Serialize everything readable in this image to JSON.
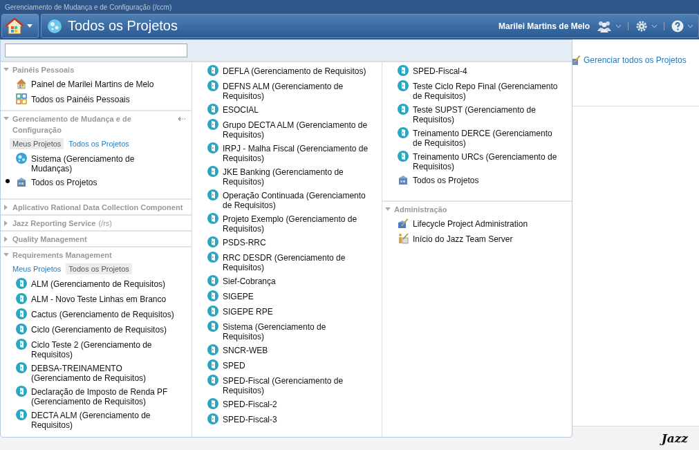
{
  "app_bar": {
    "title": "Gerenciamento de Mudança e de Configuração (/ccm)"
  },
  "nav_bar": {
    "page_title": "Todos os Projetos",
    "user_name": "Marilei Martins de Melo"
  },
  "manage_link": "Gerenciar todos os Projetos",
  "footer": {
    "logo": "Jazz"
  },
  "menu": {
    "columns": [
      {
        "sections": [
          {
            "title": "Painéis Pessoais",
            "expanded": true,
            "items": [
              {
                "label": "Painel de Marilei Martins de Melo",
                "kind": "home",
                "current": false
              },
              {
                "label": "Todos os Painéis Pessoais",
                "kind": "dashboards",
                "current": false
              }
            ]
          },
          {
            "title": "Gerenciamento de Mudança e de Configuração",
            "expanded": true,
            "tabs": [
              {
                "label": "Meus Projetos",
                "selected": true
              },
              {
                "label": "Todos os Projetos",
                "selected": false
              }
            ],
            "items": [
              {
                "label": "Sistema (Gerenciamento de Mudanças)",
                "kind": "globe",
                "current": false
              },
              {
                "label": "Todos os Projetos",
                "kind": "all-projects",
                "current": true
              }
            ]
          },
          {
            "title": "Aplicativo Rational Data Collection Component",
            "expanded": false
          },
          {
            "title": "Jazz Reporting Service",
            "suffix": "(/rs)",
            "expanded": false
          },
          {
            "title": "Quality Management",
            "expanded": false
          },
          {
            "title": "Requirements Management",
            "expanded": true,
            "tabs": [
              {
                "label": "Meus Projetos",
                "selected": false
              },
              {
                "label": "Todos os Projetos",
                "selected": true
              }
            ],
            "items": [
              {
                "label": "ALM (Gerenciamento de Requisitos)",
                "kind": "project",
                "current": false
              },
              {
                "label": "ALM - Novo Teste Linhas em Branco",
                "kind": "project",
                "current": false
              },
              {
                "label": "Cactus (Gerenciamento de Requisitos)",
                "kind": "project",
                "current": false
              },
              {
                "label": "Ciclo (Gerenciamento de Requisitos)",
                "kind": "project",
                "current": false
              },
              {
                "label": "Ciclo Teste 2 (Gerenciamento de Requisitos)",
                "kind": "project",
                "current": false
              },
              {
                "label": "DEBSA-TREINAMENTO (Gerenciamento de Requisitos)",
                "kind": "project",
                "current": false
              },
              {
                "label": "Declaração de Imposto de Renda PF (Gerenciamento de Requisitos)",
                "kind": "project",
                "current": false
              },
              {
                "label": "DECTA ALM (Gerenciamento de Requisitos)",
                "kind": "project",
                "current": false
              }
            ]
          }
        ]
      },
      {
        "sections": [
          {
            "items": [
              {
                "label": "DEFLA (Gerenciamento de Requisitos)",
                "kind": "project",
                "current": false
              },
              {
                "label": "DEFNS ALM (Gerenciamento de Requisitos)",
                "kind": "project",
                "current": false
              },
              {
                "label": "ESOCIAL",
                "kind": "project",
                "current": false
              },
              {
                "label": "Grupo DECTA ALM (Gerenciamento de Requisitos)",
                "kind": "project",
                "current": false
              },
              {
                "label": "IRPJ - Malha Fiscal (Gerenciamento de Requisitos)",
                "kind": "project",
                "current": false
              },
              {
                "label": "JKE Banking (Gerenciamento de Requisitos)",
                "kind": "project",
                "current": false
              },
              {
                "label": "Operação Continuada (Gerenciamento de Requisitos)",
                "kind": "project",
                "current": false
              },
              {
                "label": "Projeto Exemplo (Gerenciamento de Requisitos)",
                "kind": "project",
                "current": false
              },
              {
                "label": "PSDS-RRC",
                "kind": "project",
                "current": false
              },
              {
                "label": "RRC DESDR (Gerenciamento de Requisitos)",
                "kind": "project",
                "current": false
              },
              {
                "label": "Sief-Cobrança",
                "kind": "project",
                "current": false
              },
              {
                "label": "SIGEPE",
                "kind": "project",
                "current": false
              },
              {
                "label": "SIGEPE RPE",
                "kind": "project",
                "current": false
              },
              {
                "label": "Sistema (Gerenciamento de Requisitos)",
                "kind": "project",
                "current": false
              },
              {
                "label": "SNCR-WEB",
                "kind": "project",
                "current": false
              },
              {
                "label": "SPED",
                "kind": "project",
                "current": false
              },
              {
                "label": "SPED-Fiscal (Gerenciamento de Requisitos)",
                "kind": "project",
                "current": false
              },
              {
                "label": "SPED-Fiscal-2",
                "kind": "project",
                "current": false
              },
              {
                "label": "SPED-Fiscal-3",
                "kind": "project",
                "current": false
              }
            ]
          }
        ]
      },
      {
        "sections": [
          {
            "items": [
              {
                "label": "SPED-Fiscal-4",
                "kind": "project",
                "current": false
              },
              {
                "label": "Teste Ciclo Repo Final (Gerenciamento de Requisitos)",
                "kind": "project",
                "current": false
              },
              {
                "label": "Teste SUPST (Gerenciamento de Requisitos)",
                "kind": "project",
                "current": false
              },
              {
                "label": "Treinamento DERCE (Gerenciamento de Requisitos)",
                "kind": "project",
                "current": false
              },
              {
                "label": "Treinamento URCs (Gerenciamento de Requisitos)",
                "kind": "project",
                "current": false
              },
              {
                "label": "Todos os Projetos",
                "kind": "all-projects",
                "current": false
              }
            ]
          },
          {
            "title": "Administração",
            "expanded": true,
            "items": [
              {
                "label": "Lifecycle Project Administration",
                "kind": "admin",
                "current": false
              },
              {
                "label": "Início do Jazz Team Server",
                "kind": "server",
                "current": false
              }
            ]
          }
        ]
      }
    ]
  }
}
